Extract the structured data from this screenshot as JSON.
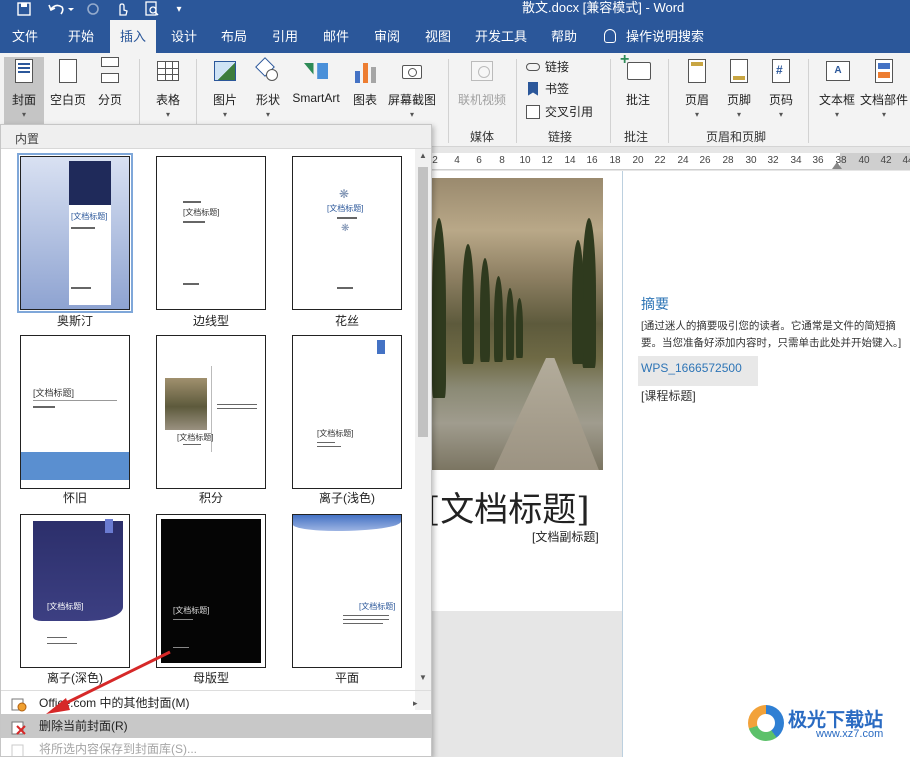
{
  "window": {
    "title": "散文.docx [兼容模式] - Word"
  },
  "quick_access": {
    "save_icon": "save-icon",
    "undo_icon": "undo-icon",
    "redo_icon": "redo-icon",
    "touch_icon": "touch-mode-icon",
    "preview_icon": "print-preview-icon",
    "more_icon": "customize-qat-icon"
  },
  "tabs": [
    "文件",
    "开始",
    "插入",
    "设计",
    "布局",
    "引用",
    "邮件",
    "审阅",
    "视图",
    "开发工具",
    "帮助"
  ],
  "active_tab": "插入",
  "tell_me": "操作说明搜索",
  "ribbon": {
    "cover": "封面",
    "blank_page": "空白页",
    "page_break": "分页",
    "table": "表格",
    "pictures": "图片",
    "shapes": "形状",
    "smartart": "SmartArt",
    "chart": "图表",
    "screenshot": "屏幕截图",
    "online_video": "联机视频",
    "link": "链接",
    "bookmark": "书签",
    "cross_ref": "交叉引用",
    "comment": "批注",
    "header": "页眉",
    "footer": "页脚",
    "page_number": "页码",
    "text_box": "文本框",
    "doc_parts": "文档部件",
    "group_media": "媒体",
    "group_links": "链接",
    "group_comments": "批注",
    "group_header_footer": "页眉和页脚"
  },
  "ruler_ticks": [
    "2",
    "4",
    "6",
    "8",
    "10",
    "12",
    "14",
    "16",
    "18",
    "20",
    "22",
    "24",
    "26",
    "28",
    "30",
    "32",
    "34",
    "36",
    "38",
    "40",
    "42",
    "44"
  ],
  "gallery": {
    "header": "内置",
    "items": [
      {
        "name": "奥斯汀",
        "title": "[文档标题]",
        "sub": "[文档副标题]"
      },
      {
        "name": "边线型",
        "title": "[文档标题]",
        "sub": "[文档副标题]"
      },
      {
        "name": "花丝",
        "title": "[文档标题]",
        "sub": "[文档副标题]"
      },
      {
        "name": "怀旧",
        "title": "[文档标题]",
        "sub": "[文档副标题]"
      },
      {
        "name": "积分",
        "title": "[文档标题]",
        "sub": "[文档副标题]"
      },
      {
        "name": "离子(浅色)",
        "title": "[文档标题]",
        "sub": "[文档副标题]"
      },
      {
        "name": "离子(深色)",
        "title": "[文档标题]",
        "sub": "[文档副标题]"
      },
      {
        "name": "母版型",
        "title": "[文档标题]",
        "sub": "[文档副标题]"
      },
      {
        "name": "平面",
        "title": "[文档标题]",
        "sub": "[文档副标题]"
      }
    ],
    "menu": {
      "more_covers": "Office.com 中的其他封面(M)",
      "remove_cover": "删除当前封面(R)",
      "save_selection": "将所选内容保存到封面库(S)..."
    }
  },
  "document": {
    "cover_title": "[文档标题]",
    "cover_subtitle": "[文档副标题]",
    "abstract_title": "摘要",
    "abstract_line1": "[通过迷人的摘要吸引您的读者。它通常是文件的简短摘",
    "abstract_line2": "要。当您准备好添加内容时，只需单击此处并开始键入。]",
    "author_field": "WPS_1666572500",
    "course_title": "[课程标题]"
  },
  "watermark": {
    "brand": "极光下载站",
    "url": "www.xz7.com"
  },
  "colors": {
    "accent": "#2b579a",
    "abstract_blue": "#2e75b6",
    "arrow_red": "#d62828"
  }
}
